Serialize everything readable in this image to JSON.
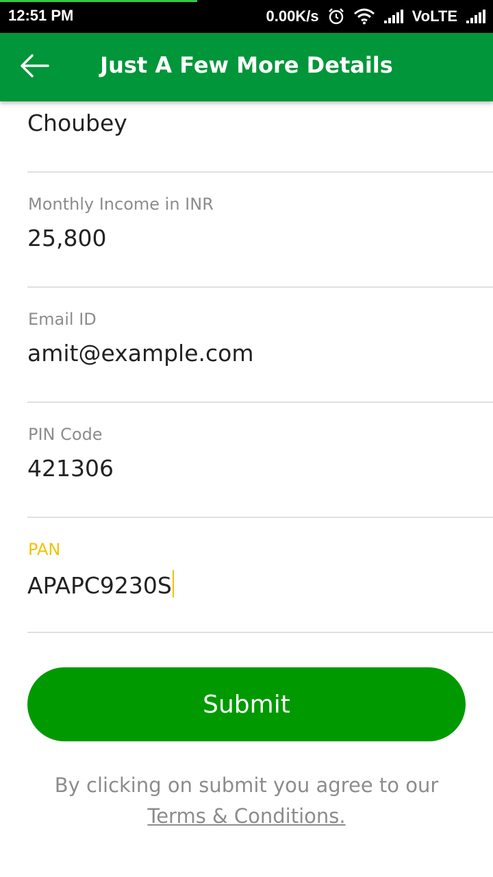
{
  "status_bar": {
    "time": "12:51 PM",
    "net_speed": "0.00K/s",
    "volte": "VoLTE",
    "icons": [
      "alarm-icon",
      "wifi-icon",
      "signal-icon",
      "signal-icon"
    ]
  },
  "app_bar": {
    "back_icon": "arrow-left-icon",
    "title": "Just A Few More Details",
    "color": "#009639"
  },
  "form": {
    "last_name": {
      "value": "Choubey"
    },
    "monthly_income": {
      "label": "Monthly Income in INR",
      "value": "25,800"
    },
    "email": {
      "label": "Email ID",
      "value": "amit@example.com"
    },
    "pin_code": {
      "label": "PIN Code",
      "value": "421306"
    },
    "pan": {
      "label": "PAN",
      "value": "APAPC9230S",
      "focused": true,
      "focus_color": "#f2c200"
    }
  },
  "submit": {
    "label": "Submit",
    "color": "#009a00"
  },
  "terms": {
    "text": "By clicking on submit you agree to our",
    "link": "Terms & Conditions."
  }
}
